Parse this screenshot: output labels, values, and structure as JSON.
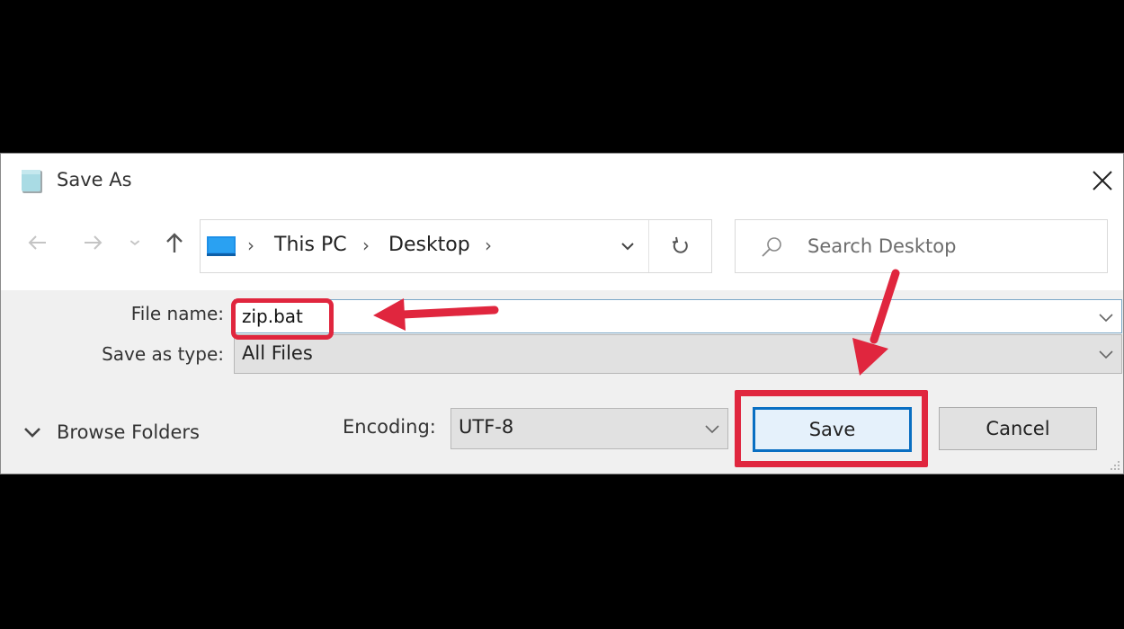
{
  "dialog": {
    "title": "Save As",
    "title_icon": "notepad-icon",
    "close_icon": "close-icon"
  },
  "navigation": {
    "back_icon": "arrow-left-icon",
    "forward_icon": "arrow-right-icon",
    "recent_icon": "chevron-down-icon",
    "up_icon": "arrow-up-icon",
    "breadcrumb": [
      {
        "label": "This PC"
      },
      {
        "label": "Desktop"
      }
    ],
    "refresh_icon": "refresh-icon"
  },
  "search": {
    "placeholder": "Search Desktop",
    "value": ""
  },
  "form": {
    "file_name_label": "File name:",
    "file_name_value": "zip.bat",
    "save_as_type_label": "Save as type:",
    "save_as_type_value": "All Files",
    "encoding_label": "Encoding:",
    "encoding_value": "UTF-8"
  },
  "footer": {
    "browse_folders_label": "Browse Folders",
    "save_label": "Save",
    "cancel_label": "Cancel"
  },
  "annotations": {
    "color": "#e0263e",
    "items": [
      {
        "type": "highlight-box",
        "target": "file-name"
      },
      {
        "type": "arrow",
        "target": "file-name"
      },
      {
        "type": "arrow",
        "target": "save-button"
      },
      {
        "type": "highlight-box",
        "target": "save-button"
      }
    ]
  }
}
